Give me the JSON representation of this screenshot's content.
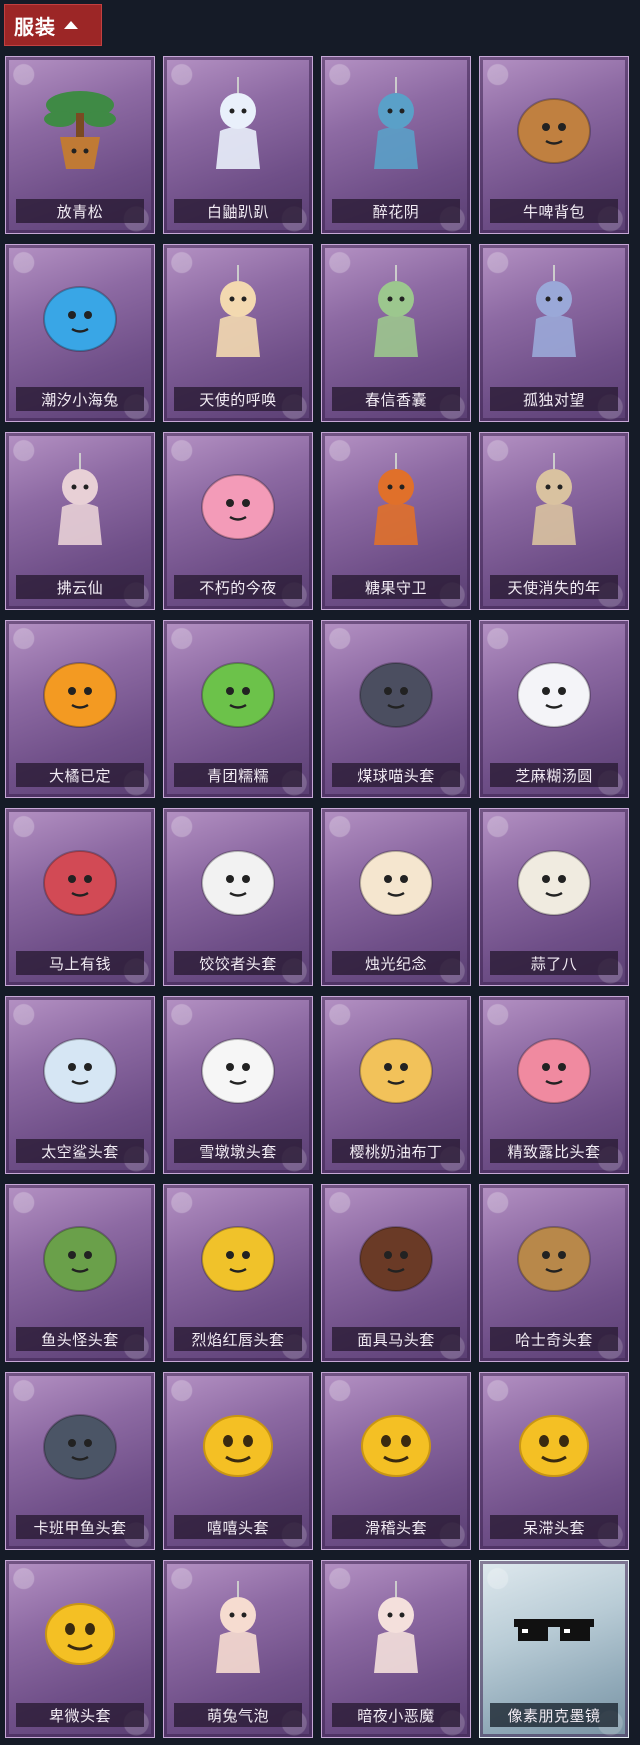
{
  "header": {
    "title": "服装"
  },
  "items": [
    {
      "name": "放青松",
      "icon": "bonsai-pine-icon",
      "color": "#3f8a45"
    },
    {
      "name": "白鼬趴趴",
      "icon": "white-weasel-icon",
      "color": "#e9f0fb"
    },
    {
      "name": "醉花阴",
      "icon": "dreamcatcher-icon",
      "color": "#5aa0c8"
    },
    {
      "name": "牛啤背包",
      "icon": "cow-beer-mug-icon",
      "color": "#c08040"
    },
    {
      "name": "潮汐小海兔",
      "icon": "sea-bunny-icon",
      "color": "#39a6e6"
    },
    {
      "name": "天使的呼唤",
      "icon": "angel-figure-icon",
      "color": "#f3d9b0"
    },
    {
      "name": "春信香囊",
      "icon": "scent-pouch-icon",
      "color": "#9cc78e"
    },
    {
      "name": "孤独对望",
      "icon": "charm-figure-icon",
      "color": "#9aa8d8"
    },
    {
      "name": "拂云仙",
      "icon": "fairy-charm-icon",
      "color": "#e8d0d6"
    },
    {
      "name": "不朽的今夜",
      "icon": "pink-fox-bowl-icon",
      "color": "#f39bb8"
    },
    {
      "name": "糖果守卫",
      "icon": "pumpkin-charm-icon",
      "color": "#e0702a"
    },
    {
      "name": "天使消失的年",
      "icon": "angel-girl-icon",
      "color": "#d9c2a0"
    },
    {
      "name": "大橘已定",
      "icon": "orange-slice-icon",
      "color": "#f39a22"
    },
    {
      "name": "青团糯糯",
      "icon": "green-mochi-icon",
      "color": "#6cc24a"
    },
    {
      "name": "煤球喵头套",
      "icon": "black-cat-head-icon",
      "color": "#4b4e60"
    },
    {
      "name": "芝麻糊汤圆",
      "icon": "rice-ball-icon",
      "color": "#f4f4f8"
    },
    {
      "name": "马上有钱",
      "icon": "red-horse-head-icon",
      "color": "#d24a55"
    },
    {
      "name": "饺饺者头套",
      "icon": "dumpling-head-icon",
      "color": "#f2f2f2"
    },
    {
      "name": "烛光纪念",
      "icon": "candle-head-icon",
      "color": "#f5e6cf"
    },
    {
      "name": "蒜了八",
      "icon": "garlic-head-icon",
      "color": "#f0ebe0"
    },
    {
      "name": "太空鲨头套",
      "icon": "shark-head-icon",
      "color": "#d6e6f4"
    },
    {
      "name": "雪墩墩头套",
      "icon": "snowman-head-icon",
      "color": "#f6f6f6"
    },
    {
      "name": "樱桃奶油布丁",
      "icon": "pudding-head-icon",
      "color": "#f2c25a"
    },
    {
      "name": "精致露比头套",
      "icon": "pink-beaver-head-icon",
      "color": "#f08aa0"
    },
    {
      "name": "鱼头怪头套",
      "icon": "fish-head-icon",
      "color": "#6aa04a"
    },
    {
      "name": "烈焰红唇头套",
      "icon": "yellow-mouse-head-icon",
      "color": "#f0c22a"
    },
    {
      "name": "面具马头套",
      "icon": "horse-mask-icon",
      "color": "#6a3a26"
    },
    {
      "name": "哈士奇头套",
      "icon": "dog-head-icon",
      "color": "#b8884a"
    },
    {
      "name": "卡班甲鱼头套",
      "icon": "whale-head-icon",
      "color": "#4b5566"
    },
    {
      "name": "嘻嘻头套",
      "icon": "grin-emoji-icon",
      "color": "#f4c024"
    },
    {
      "name": "滑稽头套",
      "icon": "smirk-emoji-icon",
      "color": "#f4c024"
    },
    {
      "name": "呆滞头套",
      "icon": "stare-emoji-icon",
      "color": "#f4c024"
    },
    {
      "name": "卑微头套",
      "icon": "humble-emoji-icon",
      "color": "#f4c024"
    },
    {
      "name": "萌兔气泡",
      "icon": "bunny-bubble-icon",
      "color": "#f6dcd0"
    },
    {
      "name": "暗夜小恶魔",
      "icon": "devil-figure-icon",
      "color": "#f4e0dc"
    },
    {
      "name": "像素朋克墨镜",
      "icon": "pixel-sunglasses-icon",
      "color": "#111111",
      "rare": true
    }
  ]
}
